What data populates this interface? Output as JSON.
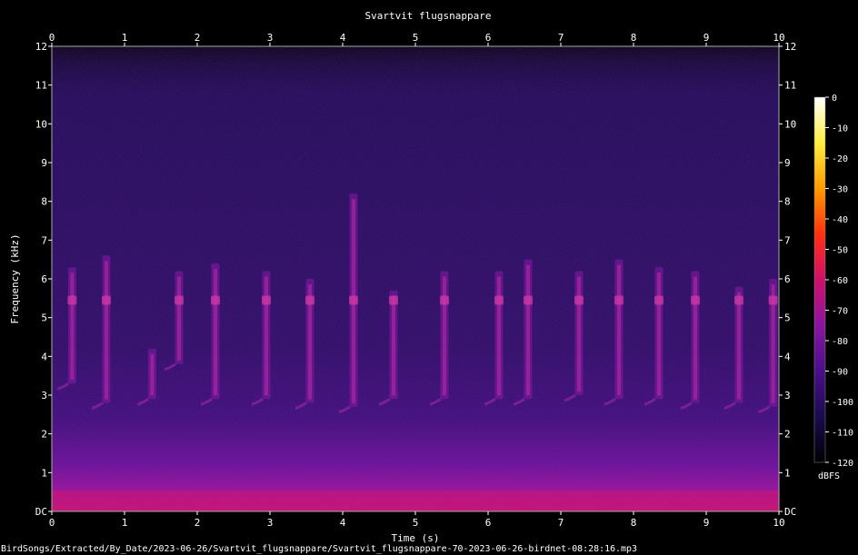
{
  "chart_data": {
    "type": "heatmap",
    "title": "Svartvit flugsnappare",
    "xlabel": "Time (s)",
    "ylabel": "Frequency (kHz)",
    "xlim": [
      0,
      10
    ],
    "ylim": [
      0,
      12
    ],
    "x_ticks": [
      "0",
      "1",
      "2",
      "3",
      "4",
      "5",
      "6",
      "7",
      "8",
      "9",
      "10"
    ],
    "y_ticks": [
      "DC",
      "1",
      "2",
      "3",
      "4",
      "5",
      "6",
      "7",
      "8",
      "9",
      "10",
      "11",
      "12"
    ],
    "colorbar": {
      "label": "dBFS",
      "range": [
        -120,
        0
      ],
      "ticks": [
        "0",
        "-10",
        "-20",
        "-30",
        "-40",
        "-50",
        "-60",
        "-70",
        "-80",
        "-90",
        "-100",
        "-110",
        "-120"
      ],
      "colors": [
        "#000000",
        "#1a0a50",
        "#4a0f8a",
        "#8a15a0",
        "#d0106a",
        "#ff3010",
        "#ff9a00",
        "#ffee40",
        "#ffffff"
      ]
    },
    "background_color": "#1c0c50",
    "note_calls": [
      {
        "t": 0.28,
        "f_hi": 6.3,
        "f_lo": 3.3
      },
      {
        "t": 0.75,
        "f_hi": 6.6,
        "f_lo": 2.8
      },
      {
        "t": 1.38,
        "f_hi": 4.2,
        "f_lo": 2.9
      },
      {
        "t": 1.75,
        "f_hi": 6.2,
        "f_lo": 3.8
      },
      {
        "t": 2.25,
        "f_hi": 6.4,
        "f_lo": 2.9
      },
      {
        "t": 2.95,
        "f_hi": 6.2,
        "f_lo": 2.9
      },
      {
        "t": 3.55,
        "f_hi": 6.0,
        "f_lo": 2.8
      },
      {
        "t": 4.15,
        "f_hi": 8.2,
        "f_lo": 2.7
      },
      {
        "t": 4.7,
        "f_hi": 5.7,
        "f_lo": 2.9
      },
      {
        "t": 5.4,
        "f_hi": 6.2,
        "f_lo": 2.9
      },
      {
        "t": 6.15,
        "f_hi": 6.2,
        "f_lo": 2.9
      },
      {
        "t": 6.55,
        "f_hi": 6.5,
        "f_lo": 2.9
      },
      {
        "t": 7.25,
        "f_hi": 6.2,
        "f_lo": 3.0
      },
      {
        "t": 7.8,
        "f_hi": 6.5,
        "f_lo": 2.9
      },
      {
        "t": 8.35,
        "f_hi": 6.3,
        "f_lo": 2.9
      },
      {
        "t": 8.85,
        "f_hi": 6.2,
        "f_lo": 2.8
      },
      {
        "t": 9.45,
        "f_hi": 5.8,
        "f_lo": 2.8
      },
      {
        "t": 9.92,
        "f_hi": 6.0,
        "f_lo": 2.7
      }
    ]
  },
  "footer_path": "BirdSongs/Extracted/By_Date/2023-06-26/Svartvit_flugsnappare/Svartvit_flugsnappare-70-2023-06-26-birdnet-08:28:16.mp3"
}
